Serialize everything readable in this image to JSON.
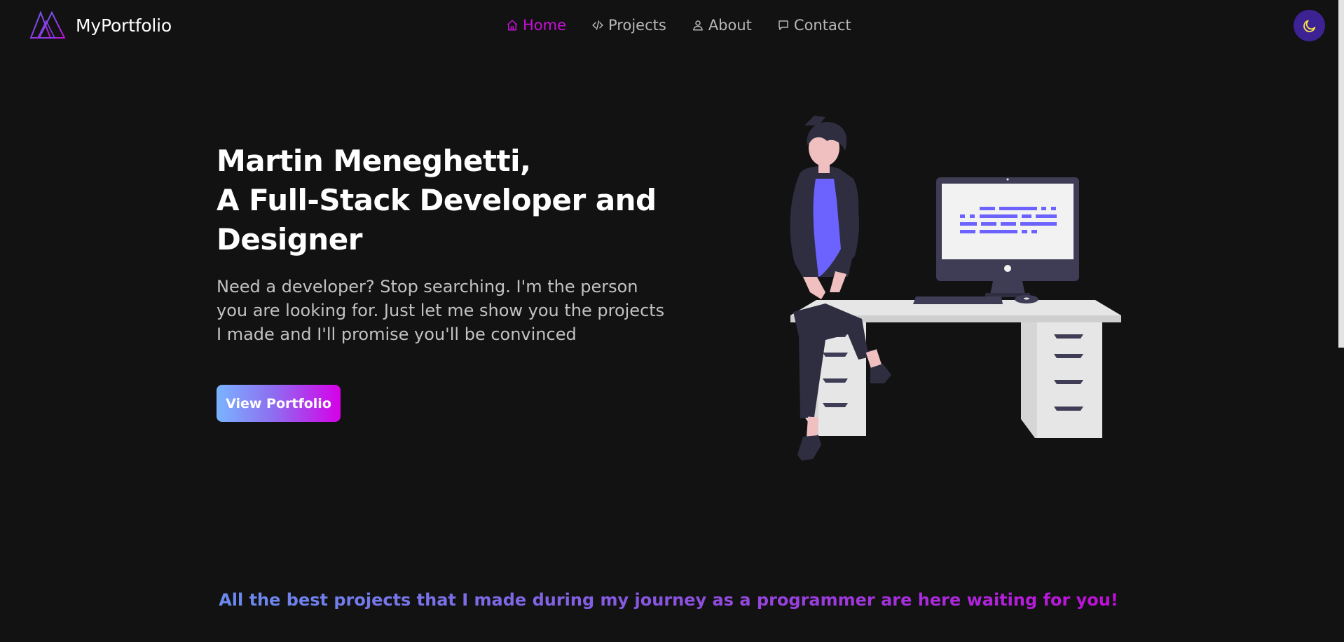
{
  "header": {
    "brand_name": "MyPortfolio",
    "brand_icon": "mountain-triangles-logo",
    "nav": [
      {
        "label": "Home",
        "icon": "home-icon",
        "active": true
      },
      {
        "label": "Projects",
        "icon": "code-icon",
        "active": false
      },
      {
        "label": "About",
        "icon": "user-icon",
        "active": false
      },
      {
        "label": "Contact",
        "icon": "chat-icon",
        "active": false
      }
    ],
    "theme_toggle_icon": "moon-icon"
  },
  "hero": {
    "title_lines": [
      "Martin Meneghetti,",
      "A Full-Stack Developer and",
      "Designer"
    ],
    "description": "Need a developer? Stop searching. I'm the person you are looking for. Just let me show you the projects I made and I'll promise you'll be convinced",
    "cta_label": "View Portfolio"
  },
  "tagline": "All the best projects that I made during my journey as a programmer are here waiting for you!",
  "colors": {
    "background": "#121212",
    "accent": "#c80ed9",
    "toggle_bg": "#3d2293",
    "illustration_accent": "#6c63ff"
  }
}
